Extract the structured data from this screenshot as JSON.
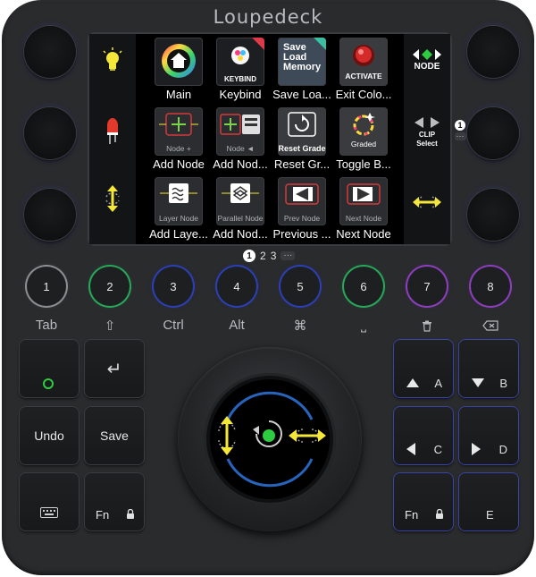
{
  "brand": "Loupedeck",
  "side_left": {
    "icons": [
      "lightbulb-icon",
      "resistor-icon",
      "vertical-move-icon"
    ]
  },
  "side_right": {
    "top_label": "NODE",
    "mid_label": "CLIP",
    "mid_sublabel": "Select",
    "icons": [
      "diamond-arrows-icon",
      "clip-select-icon",
      "horizontal-move-icon"
    ]
  },
  "grid": {
    "rows": [
      [
        {
          "label": "Main",
          "tile_text": "",
          "icon": "home-color-wheel-icon"
        },
        {
          "label": "Keybind",
          "tile_text": "KEYBIND",
          "icon": "keybind-icon"
        },
        {
          "label": "Save Loa...",
          "tile_text": "Save\nLoad\nMemory",
          "icon": "memory-icon"
        },
        {
          "label": "Exit Colo...",
          "tile_text": "ACTIVATE",
          "icon": "activate-button-icon"
        }
      ],
      [
        {
          "label": "Add Node",
          "tile_text": "Node +",
          "icon": "add-node-icon"
        },
        {
          "label": "Add Nod...",
          "tile_text": "Node ◄",
          "icon": "add-node-before-icon"
        },
        {
          "label": "Reset Gr...",
          "tile_text": "Reset Grade",
          "icon": "reset-grade-icon"
        },
        {
          "label": "Toggle B...",
          "tile_text": "Graded",
          "icon": "graded-icon"
        }
      ],
      [
        {
          "label": "Add Laye...",
          "tile_text": "Layer Node",
          "icon": "layer-node-icon"
        },
        {
          "label": "Add Nod...",
          "tile_text": "Parallel Node",
          "icon": "parallel-node-icon"
        },
        {
          "label": "Previous ...",
          "tile_text": "Prev Node",
          "icon": "prev-node-icon"
        },
        {
          "label": "Next Node",
          "tile_text": "Next Node",
          "icon": "next-node-icon"
        }
      ]
    ]
  },
  "pager": {
    "active": "1",
    "pages": [
      "2",
      "3"
    ],
    "more": "···"
  },
  "side_pager": {
    "active": "1",
    "more": "···"
  },
  "number_buttons": [
    {
      "num": "1",
      "label": "Tab",
      "ring": "#8d8e91"
    },
    {
      "num": "2",
      "label": "⇧",
      "ring": "#27a85a"
    },
    {
      "num": "3",
      "label": "Ctrl",
      "ring": "#2c3fb5"
    },
    {
      "num": "4",
      "label": "Alt",
      "ring": "#2c3fb5"
    },
    {
      "num": "5",
      "label": "⌘",
      "ring": "#2c3fb5"
    },
    {
      "num": "6",
      "label": "⎵",
      "ring": "#27a85a"
    },
    {
      "num": "7",
      "label": "trash-icon",
      "ring": "#8b3fbf"
    },
    {
      "num": "8",
      "label": "backspace-icon",
      "ring": "#8b3fbf"
    }
  ],
  "left_keys": {
    "circle": "",
    "enter": "↵",
    "undo": "Undo",
    "save": "Save",
    "keyboard": "",
    "fn": "Fn"
  },
  "right_keys": {
    "a": "A",
    "b": "B",
    "c": "C",
    "d": "D",
    "fn": "Fn",
    "e": "E"
  },
  "colors": {
    "accent_yellow": "#f5e63a",
    "accent_green": "#2ecc40",
    "accent_blue": "#3a8df0",
    "accent_purple": "#8b3fbf",
    "device": "#2a2b2d"
  }
}
